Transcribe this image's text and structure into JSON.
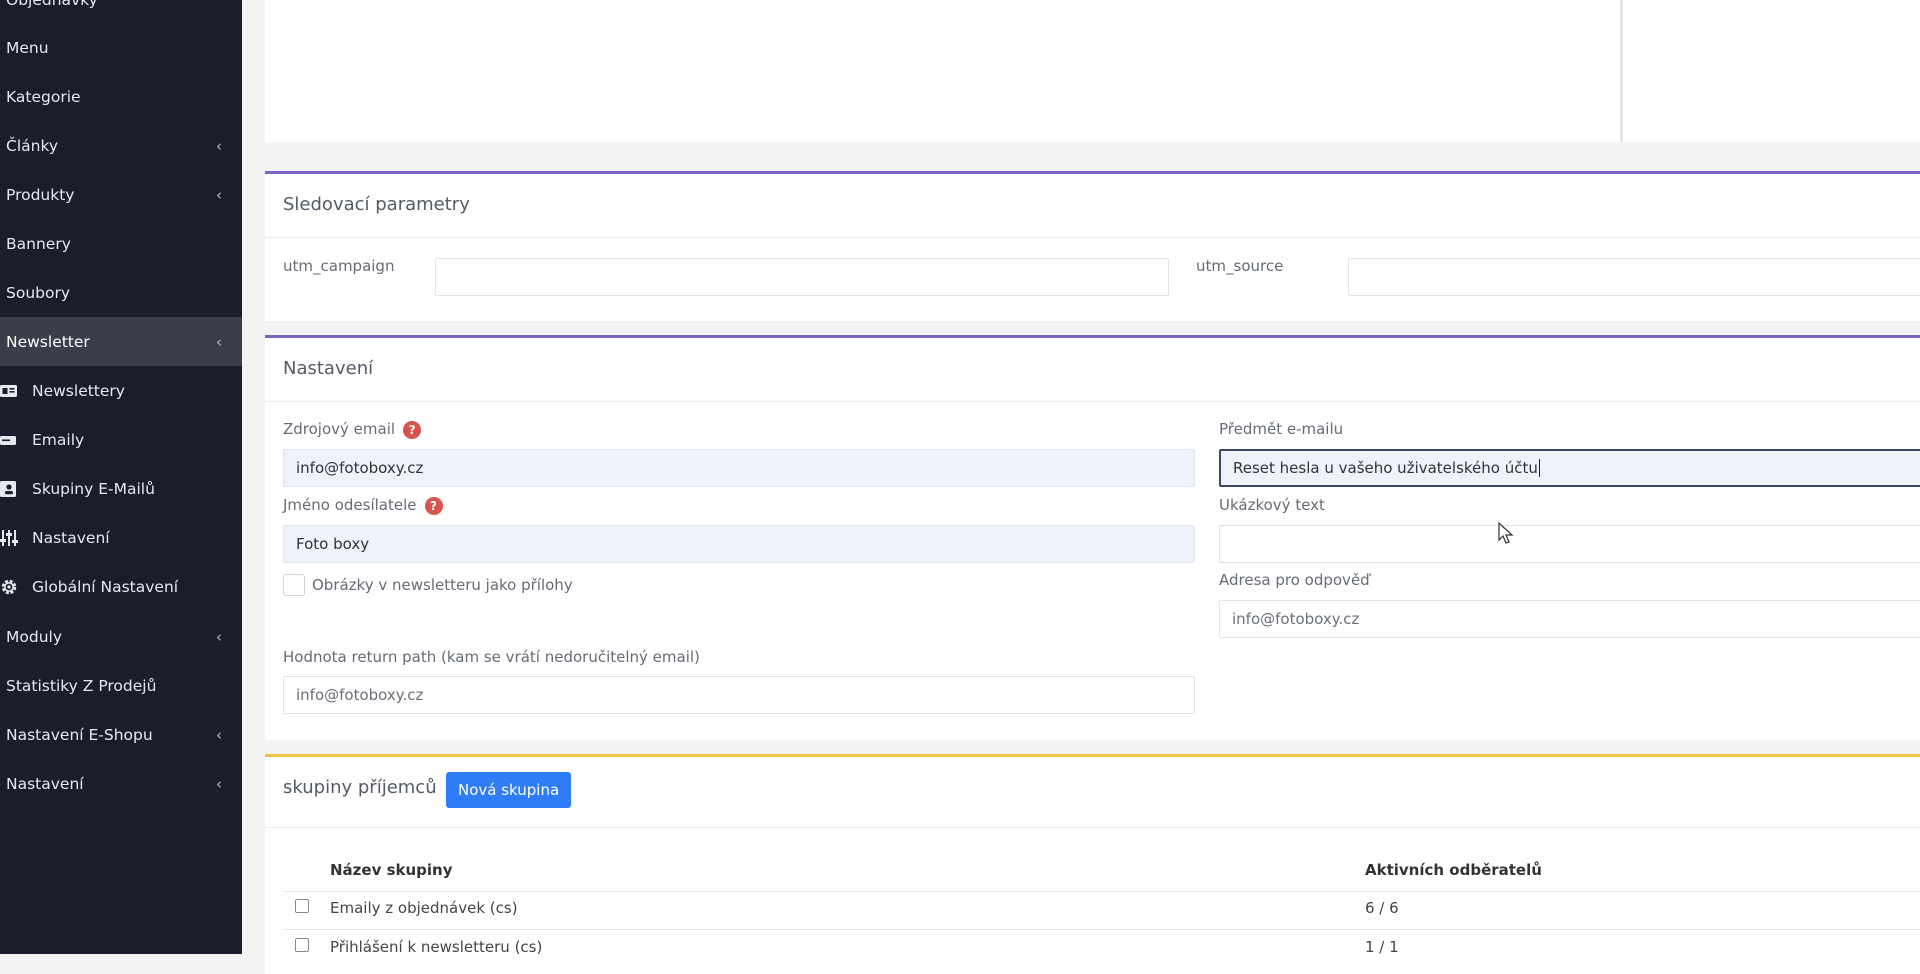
{
  "sidebar": {
    "items": [
      {
        "label": "Objednávky",
        "chevron": false
      },
      {
        "label": "Menu",
        "chevron": false
      },
      {
        "label": "Kategorie",
        "chevron": false
      },
      {
        "label": "Články",
        "chevron": true
      },
      {
        "label": "Produkty",
        "chevron": true
      },
      {
        "label": "Bannery",
        "chevron": false
      },
      {
        "label": "Soubory",
        "chevron": false
      },
      {
        "label": "Newsletter",
        "chevron": true,
        "active": true
      },
      {
        "label": "Newslettery",
        "sub": true,
        "icon": "newsletter-icon"
      },
      {
        "label": "Emaily",
        "sub": true,
        "icon": "email-icon"
      },
      {
        "label": "Skupiny E-Mailů",
        "sub": true,
        "icon": "contacts-icon"
      },
      {
        "label": "Nastavení",
        "sub": true,
        "icon": "sliders-icon"
      },
      {
        "label": "Globální Nastavení",
        "sub": true,
        "icon": "gear-icon"
      },
      {
        "label": "Moduly",
        "chevron": true
      },
      {
        "label": "Statistiky Z Prodejů",
        "chevron": false
      },
      {
        "label": "Nastavení E-Shopu",
        "chevron": true
      },
      {
        "label": "Nastavení",
        "chevron": true
      }
    ],
    "chevron_glyph": "‹"
  },
  "tracking": {
    "title": "Sledovací parametry",
    "utm_campaign_label": "utm_campaign",
    "utm_campaign_value": "",
    "utm_source_label": "utm_source",
    "utm_source_value": ""
  },
  "settings": {
    "title": "Nastavení",
    "source_email_label": "Zdrojový email",
    "source_email_value": "info@fotoboxy.cz",
    "sender_name_label": "Jméno odesílatele",
    "sender_name_value": "Foto boxy",
    "images_attachments_label": "Obrázky v newsletteru jako přílohy",
    "return_path_label": "Hodnota return path (kam se vrátí nedoručitelný email)",
    "return_path_placeholder": "info@fotoboxy.cz",
    "subject_label": "Předmět e-mailu",
    "subject_value": "Reset hesla u vašeho uživatelského účtu",
    "preview_text_label": "Ukázkový text",
    "preview_text_value": "",
    "reply_to_label": "Adresa pro odpověď",
    "reply_to_placeholder": "info@fotoboxy.cz",
    "help_glyph": "?"
  },
  "groups": {
    "title": "skupiny příjemců",
    "new_group_button": "Nová skupina",
    "columns": {
      "name": "Název skupiny",
      "active": "Aktivních odběratelů"
    },
    "rows": [
      {
        "name": "Emaily z objednávek (cs)",
        "active": "6 / 6"
      },
      {
        "name": "Přihlášení k newsletteru (cs)",
        "active": "1 / 1"
      }
    ]
  },
  "colors": {
    "sidebar_bg": "#1b1d2a",
    "accent_purple": "#7b63c9",
    "accent_yellow": "#f2c340",
    "primary_button": "#2f7df6",
    "help_red": "#d9534f"
  }
}
